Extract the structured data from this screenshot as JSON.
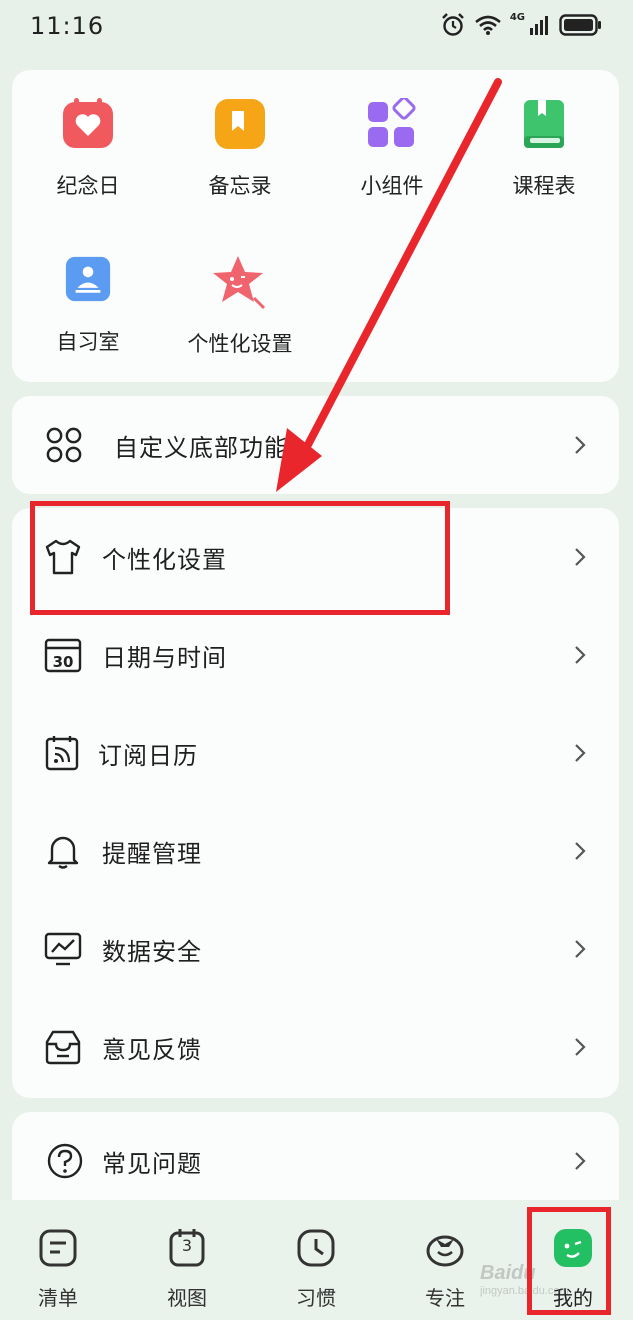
{
  "status_bar": {
    "time": "11:16",
    "network": "4G",
    "icons": [
      "alarm-icon",
      "wifi-icon",
      "signal-icon",
      "battery-icon"
    ]
  },
  "shortcuts": [
    {
      "label": "纪念日",
      "icon": "heart-calendar-icon",
      "color": "#f05a5e"
    },
    {
      "label": "备忘录",
      "icon": "bookmark-icon",
      "color": "#f6a516"
    },
    {
      "label": "小组件",
      "icon": "widgets-icon",
      "color": "#9a6bf0"
    },
    {
      "label": "课程表",
      "icon": "book-icon",
      "color": "#3dc46d"
    },
    {
      "label": "自习室",
      "icon": "study-room-icon",
      "color": "#5b9cf2"
    },
    {
      "label": "个性化设置",
      "icon": "star-mascot-icon",
      "color": "#f0646e"
    }
  ],
  "custom_row": {
    "label": "自定义底部功能",
    "icon": "grid-circles-icon"
  },
  "menu": [
    {
      "label": "个性化设置",
      "icon": "tshirt-icon"
    },
    {
      "label": "日期与时间",
      "icon": "calendar-30-icon"
    },
    {
      "label": "订阅日历",
      "icon": "rss-calendar-icon"
    },
    {
      "label": "提醒管理",
      "icon": "bell-icon"
    },
    {
      "label": "数据安全",
      "icon": "monitor-chart-icon"
    },
    {
      "label": "意见反馈",
      "icon": "inbox-icon"
    }
  ],
  "faq_row": {
    "label": "常见问题",
    "icon": "question-icon"
  },
  "bottom_nav": [
    {
      "label": "清单",
      "icon": "list-icon"
    },
    {
      "label": "视图",
      "icon": "calendar-icon",
      "badge": "3"
    },
    {
      "label": "习惯",
      "icon": "clock-icon"
    },
    {
      "label": "专注",
      "icon": "tomato-icon"
    },
    {
      "label": "我的",
      "icon": "face-icon",
      "active": true
    }
  ],
  "colors": {
    "background": "#e7f1ea",
    "card": "#fbfdfc",
    "accent_green": "#22c063",
    "annotation_red": "#e8262c"
  },
  "watermark": {
    "brand": "Baidu",
    "sub": "jingyan.baidu.com"
  }
}
